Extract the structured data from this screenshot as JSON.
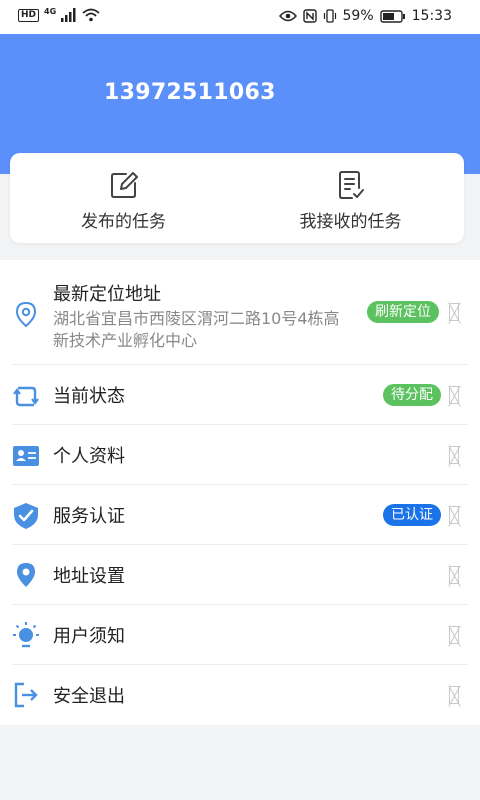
{
  "status_bar": {
    "hd": "HD",
    "network": "4G",
    "battery_percent": "59%",
    "time": "15:33"
  },
  "header": {
    "phone": "13972511063",
    "background_color": "#5b8ff9"
  },
  "task_buttons": [
    {
      "label": "发布的任务",
      "icon": "edit-icon"
    },
    {
      "label": "我接收的任务",
      "icon": "checklist-icon"
    }
  ],
  "menu": {
    "location": {
      "title": "最新定位地址",
      "address": "湖北省宜昌市西陵区渭河二路10号4栋高新技术产业孵化中心",
      "action": "刷新定位"
    },
    "status": {
      "title": "当前状态",
      "badge": "待分配"
    },
    "profile": {
      "title": "个人资料"
    },
    "certification": {
      "title": "服务认证",
      "badge": "已认证"
    },
    "address_settings": {
      "title": "地址设置"
    },
    "user_notice": {
      "title": "用户须知"
    },
    "logout": {
      "title": "安全退出"
    }
  },
  "colors": {
    "accent": "#5b8ff9",
    "badge_green": "#5bc25f",
    "badge_blue": "#1a73e8",
    "icon_blue": "#4a90e2"
  }
}
